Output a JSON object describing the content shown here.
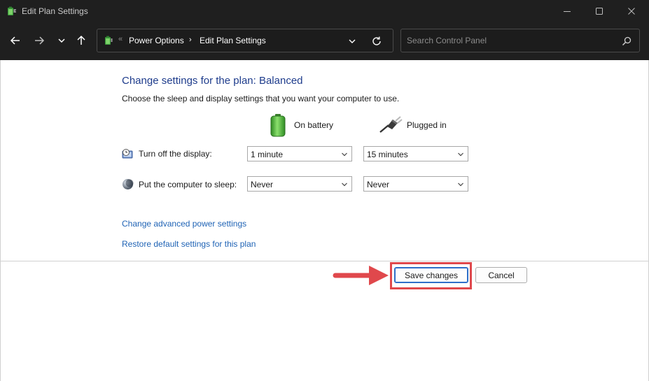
{
  "window": {
    "title": "Edit Plan Settings"
  },
  "address_bar": {
    "separator": "«",
    "breadcrumbs": [
      "Power Options",
      "Edit Plan Settings"
    ],
    "crumb_arrow": "›"
  },
  "search": {
    "placeholder": "Search Control Panel"
  },
  "main": {
    "heading": "Change settings for the plan: Balanced",
    "description": "Choose the sleep and display settings that you want your computer to use.",
    "columns": {
      "battery": "On battery",
      "plugged": "Plugged in"
    },
    "rows": [
      {
        "label": "Turn off the display:",
        "battery_value": "1 minute",
        "plugged_value": "15 minutes"
      },
      {
        "label": "Put the computer to sleep:",
        "battery_value": "Never",
        "plugged_value": "Never"
      }
    ],
    "links": {
      "advanced": "Change advanced power settings",
      "restore": "Restore default settings for this plan"
    }
  },
  "footer": {
    "save_label": "Save changes",
    "cancel_label": "Cancel"
  },
  "colors": {
    "titlebar_bg": "#1f1f1f",
    "heading_blue": "#1e3c8c",
    "link_blue": "#1f63b5",
    "annotation_red": "#e0484c",
    "battery_green": "#3fae2a"
  },
  "icons": [
    "power-options-icon",
    "minimize-icon",
    "maximize-icon",
    "close-icon",
    "back-arrow-icon",
    "forward-arrow-icon",
    "recent-locations-chevron-icon",
    "up-arrow-icon",
    "address-dropdown-icon",
    "refresh-icon",
    "search-icon",
    "battery-icon",
    "power-plug-icon",
    "display-timer-icon",
    "sleep-moon-icon",
    "dropdown-chevron-icon",
    "annotation-arrow"
  ]
}
